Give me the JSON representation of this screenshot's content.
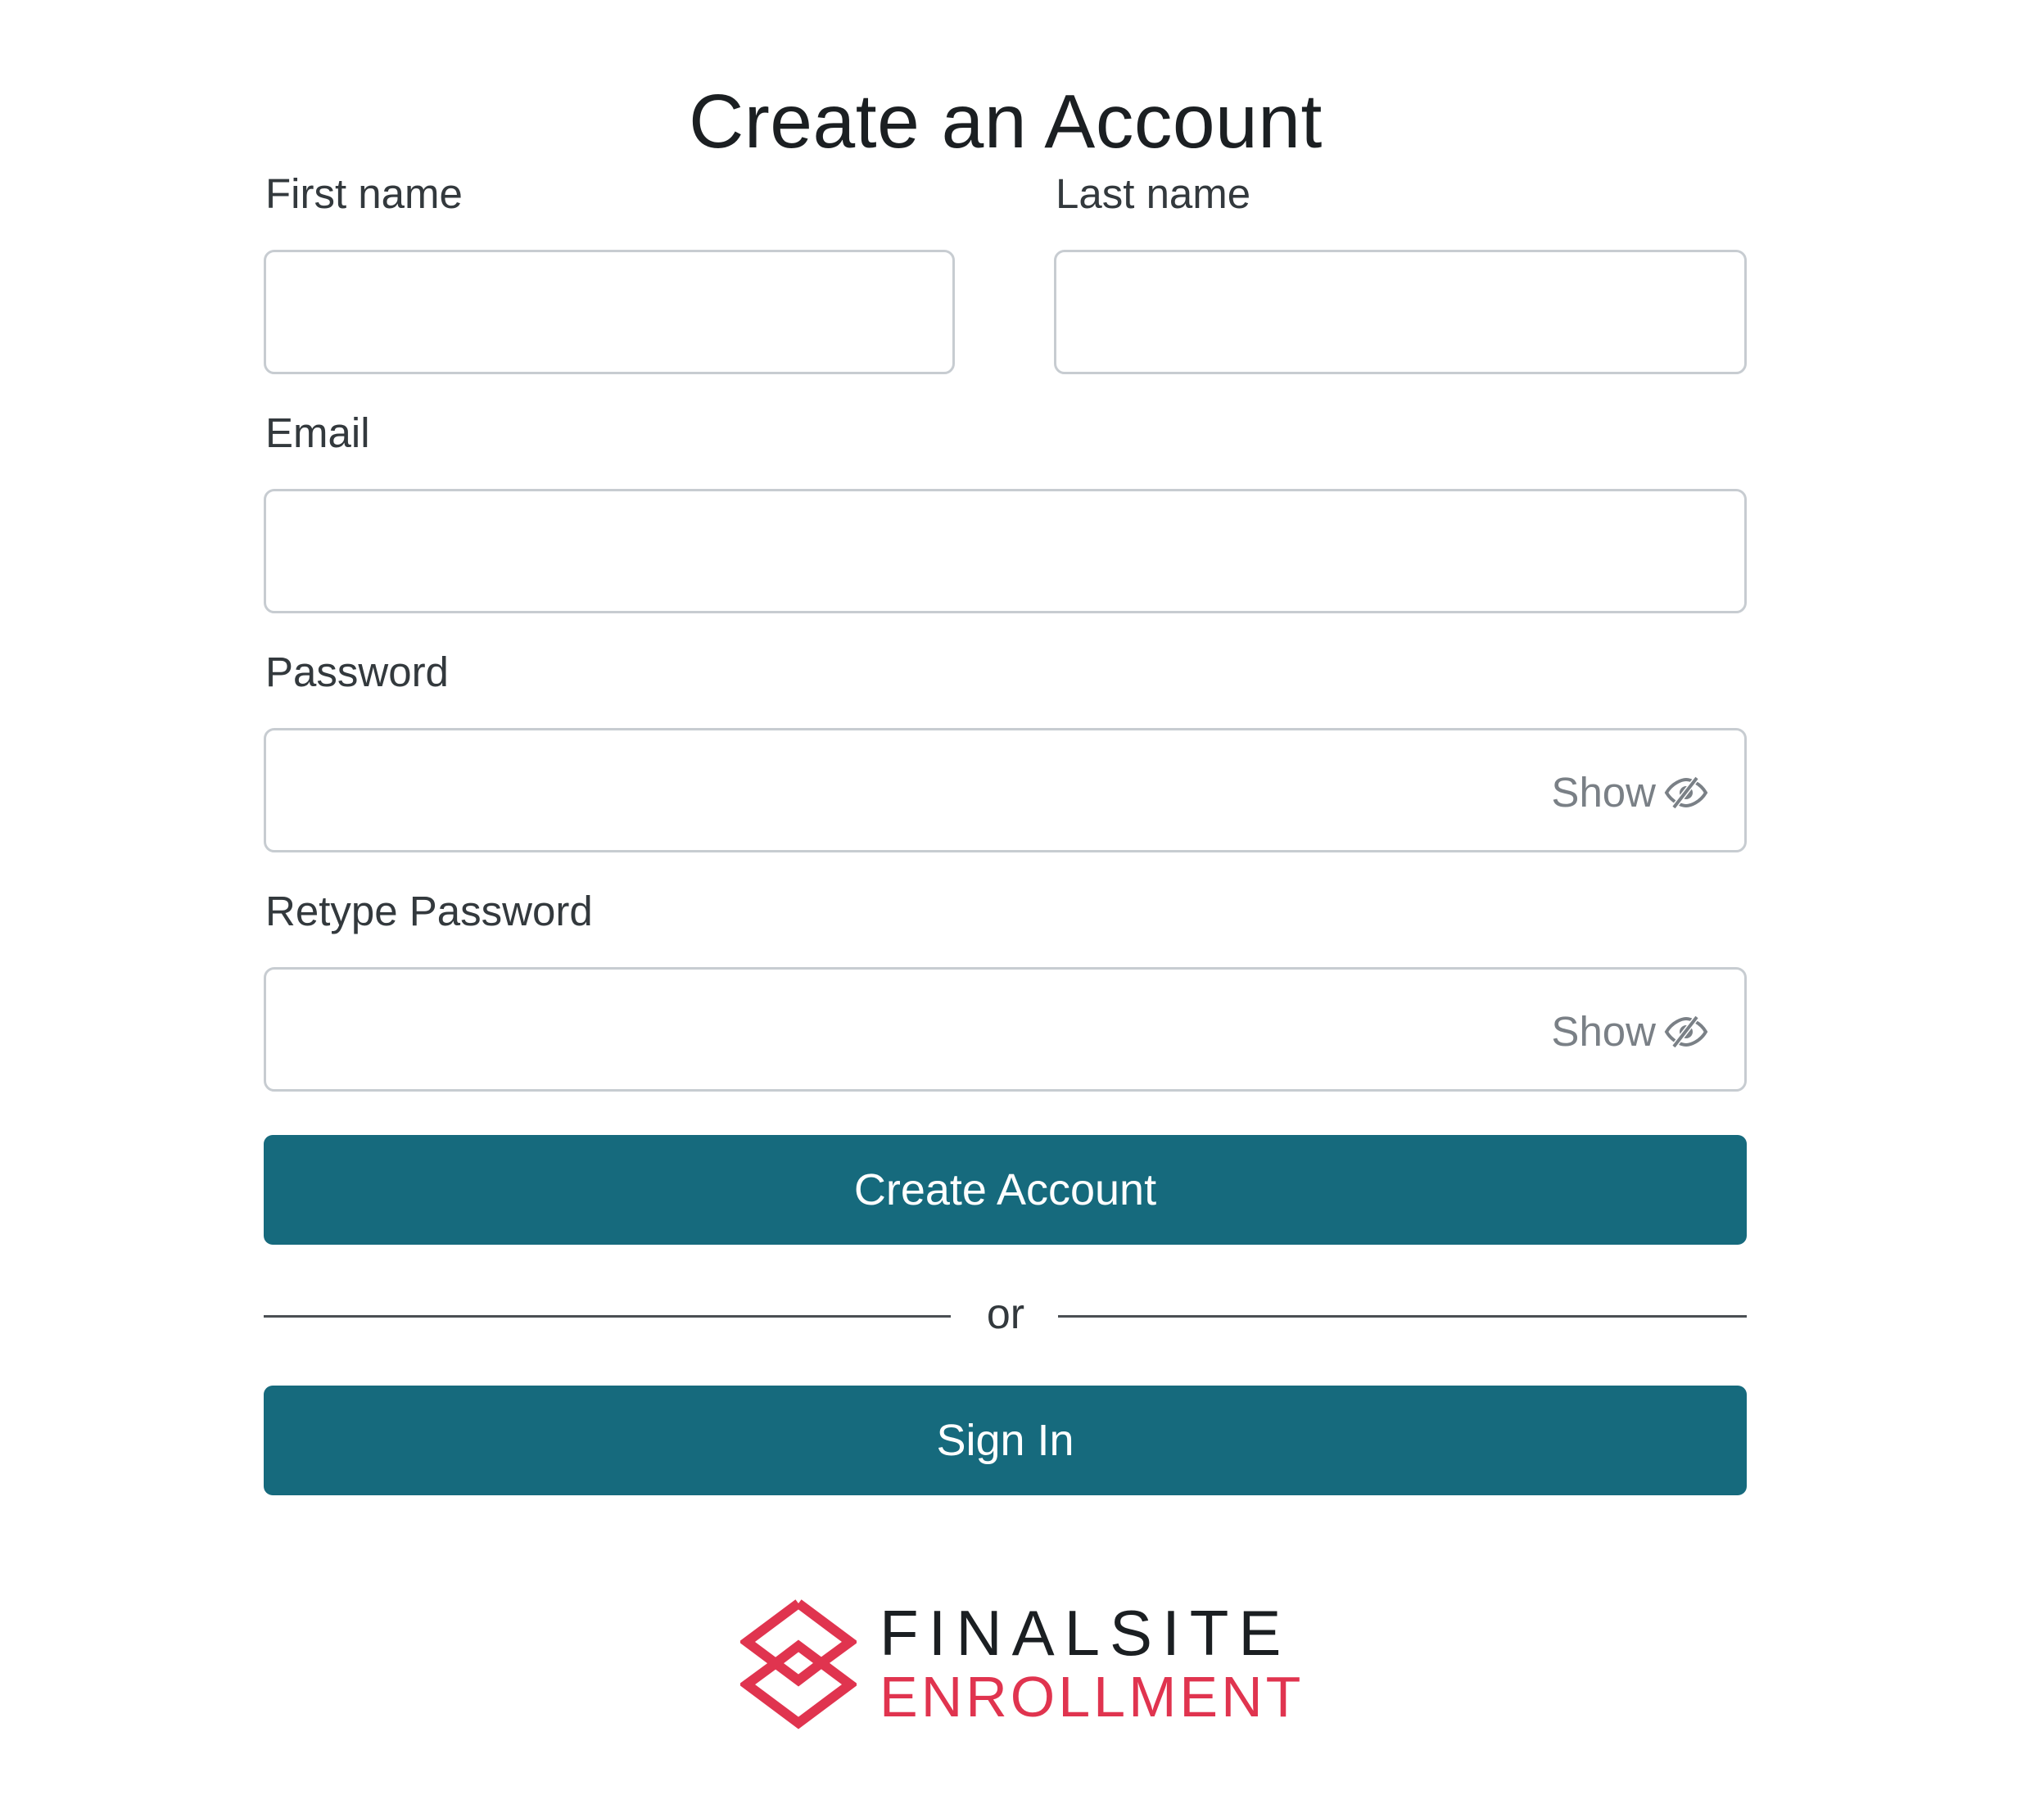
{
  "page": {
    "title": "Create an Account"
  },
  "form": {
    "first_name": {
      "label": "First name",
      "value": "",
      "placeholder": ""
    },
    "last_name": {
      "label": "Last name",
      "value": "",
      "placeholder": ""
    },
    "email": {
      "label": "Email",
      "value": "",
      "placeholder": ""
    },
    "password": {
      "label": "Password",
      "value": "",
      "placeholder": "",
      "toggle_label": "Show",
      "toggle_icon": "eye-slash-icon"
    },
    "retype_password": {
      "label": "Retype Password",
      "value": "",
      "placeholder": "",
      "toggle_label": "Show",
      "toggle_icon": "eye-slash-icon"
    }
  },
  "actions": {
    "create_account_label": "Create Account",
    "divider_text": "or",
    "sign_in_label": "Sign In"
  },
  "branding": {
    "logo_top": "FINALSITE",
    "logo_bottom": "ENROLLMENT",
    "logo_icon": "finalsite-diamond-logo-icon"
  },
  "colors": {
    "primary_button": "#166a7d",
    "brand_red": "#e0344f",
    "input_border": "#c7ccd1",
    "toggle_text": "#7a8086"
  }
}
